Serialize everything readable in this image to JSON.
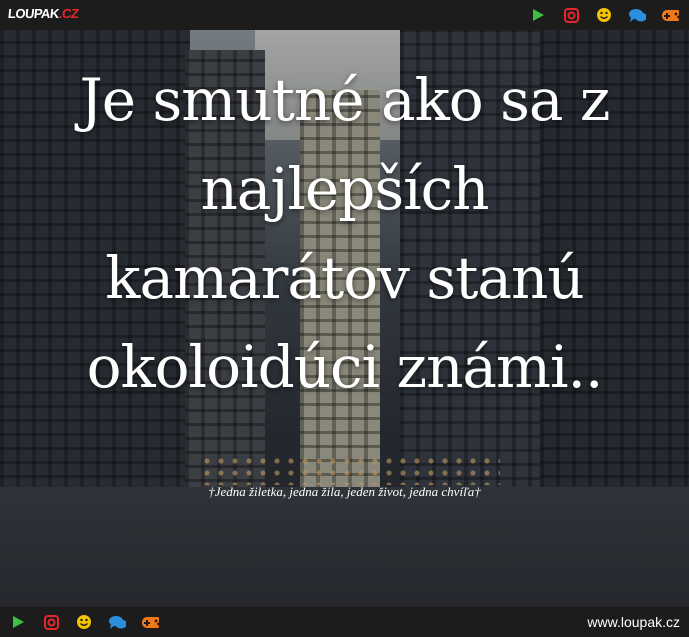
{
  "header": {
    "logo_main": "LOUPAK",
    "logo_dot": ".",
    "logo_cz": "CZ",
    "icons": [
      "play-icon",
      "instagram-icon",
      "smiley-icon",
      "chat-icon",
      "gamepad-icon"
    ]
  },
  "content": {
    "quote_lines": [
      "Je smutné ako sa z",
      "najlepších",
      "kamarátov stanú",
      "okoloidúci známi.."
    ],
    "signature": "†Jedna žiletka, jedna žila, jeden život, jedna chvíľa†"
  },
  "footer": {
    "site_url": "www.loupak.cz",
    "icons": [
      "play-icon",
      "instagram-icon",
      "smiley-icon",
      "chat-icon",
      "gamepad-icon"
    ]
  },
  "colors": {
    "bar_bg": "#1c1c1c",
    "play": "#3fbf3f",
    "instagram": "#e8262b",
    "smiley": "#f5c400",
    "chat": "#2b8fe0",
    "gamepad": "#f07a1a"
  }
}
